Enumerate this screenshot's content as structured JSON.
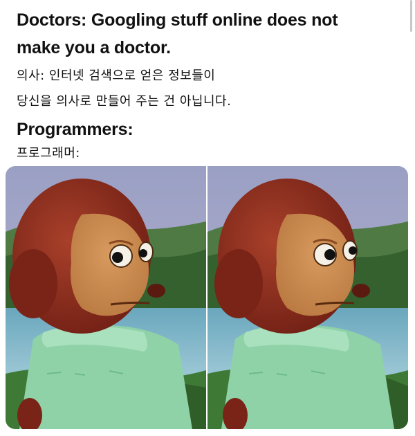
{
  "caption": {
    "doctors_en_1": "Doctors:  Googling stuff online does not",
    "doctors_en_2": "make you a doctor.",
    "doctors_ko_1": "의사: 인터넷 검색으로 얻은 정보들이",
    "doctors_ko_2": "당신을 의사로 만들어 주는 건 아닙니다.",
    "programmers_en": "Programmers:",
    "programmers_ko": "프로그래머:"
  },
  "image": {
    "panels": [
      "puppet-looking-left",
      "puppet-looking-away"
    ],
    "colors": {
      "sky": "#a9a7c9",
      "hills": "#3f6a3a",
      "water": "#7fb6c9",
      "fur": "#8a2a1c",
      "face": "#c88a4e",
      "shirt": "#8fd2a8"
    }
  }
}
